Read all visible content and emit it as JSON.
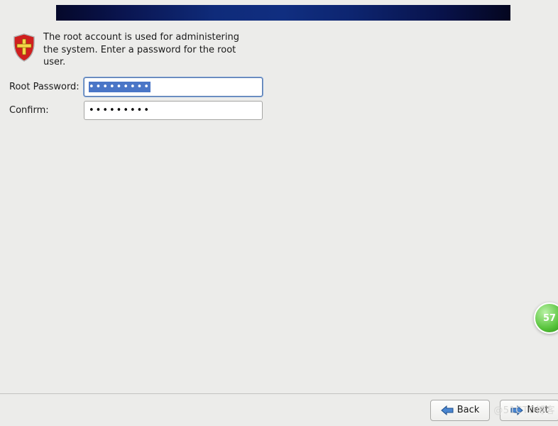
{
  "description": "The root account is used for administering the system.  Enter a password for the root user.",
  "form": {
    "root_password_label": "Root Password:",
    "confirm_label": "Confirm:",
    "root_password_value": "•••••••••",
    "confirm_value": "•••••••••"
  },
  "nav": {
    "back_label": "Back",
    "next_label": "Next"
  },
  "watermark": "@51CTO博客",
  "badge": "57",
  "colors": {
    "banner_start": "#05082a",
    "banner_mid": "#102e80",
    "bg": "#ececea",
    "arrow_blue": "#3a77c0",
    "shield_red": "#cc1f1f"
  }
}
